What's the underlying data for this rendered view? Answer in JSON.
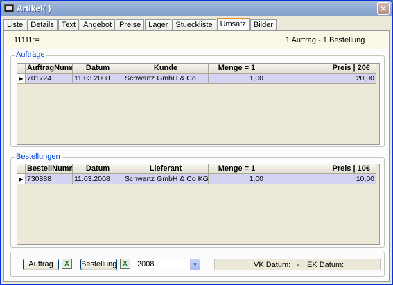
{
  "window": {
    "title": "Artikel{ }",
    "close_label": "✕"
  },
  "tabs": [
    {
      "label": "Liste"
    },
    {
      "label": "Details"
    },
    {
      "label": "Text"
    },
    {
      "label": "Angebot"
    },
    {
      "label": "Preise"
    },
    {
      "label": "Lager"
    },
    {
      "label": "Stueckliste"
    },
    {
      "label": "Umsatz",
      "active": true
    },
    {
      "label": "Bilder"
    }
  ],
  "info": {
    "left": "11111:=",
    "right": "1 Auftrag - 1 Bestellung"
  },
  "auftraege": {
    "legend": "Aufträge",
    "columns": [
      "AuftragNumme",
      "Datum",
      "Kunde",
      "Menge  = 1",
      "Preis    |    20€"
    ],
    "rows": [
      {
        "nr": "701724",
        "datum": "11.03.2008",
        "name": "Schwartz GmbH  & Co.",
        "menge": "1,00",
        "preis": "20,00"
      }
    ]
  },
  "bestellungen": {
    "legend": "Bestellungen",
    "columns": [
      "BestellNumme",
      "Datum",
      "Lieferant",
      "Menge  = 1",
      "Preis    |    10€"
    ],
    "rows": [
      {
        "nr": "730888",
        "datum": "11.03.2008",
        "name": "Schwartz GmbH & Co KG",
        "menge": "1,00",
        "preis": "10,00"
      }
    ]
  },
  "footer": {
    "auftrag_button": "Auftrag",
    "bestellung_button": "Bestellung",
    "excel_icon_glyph": "X",
    "year": "2008",
    "vk_label": "VK Datum:",
    "separator": "-",
    "ek_label": "EK Datum:"
  },
  "icons": {
    "app": "app-window-icon",
    "close": "close-icon",
    "excel": "excel-export-icon",
    "dropdown": "chevron-down-icon",
    "row_selector": "row-pointer-icon"
  },
  "colors": {
    "row_highlight": "#d4d4f2",
    "group_legend": "#0046d5",
    "active_tab_accent": "#e68b2c",
    "info_bar": "#fbf7e6"
  }
}
